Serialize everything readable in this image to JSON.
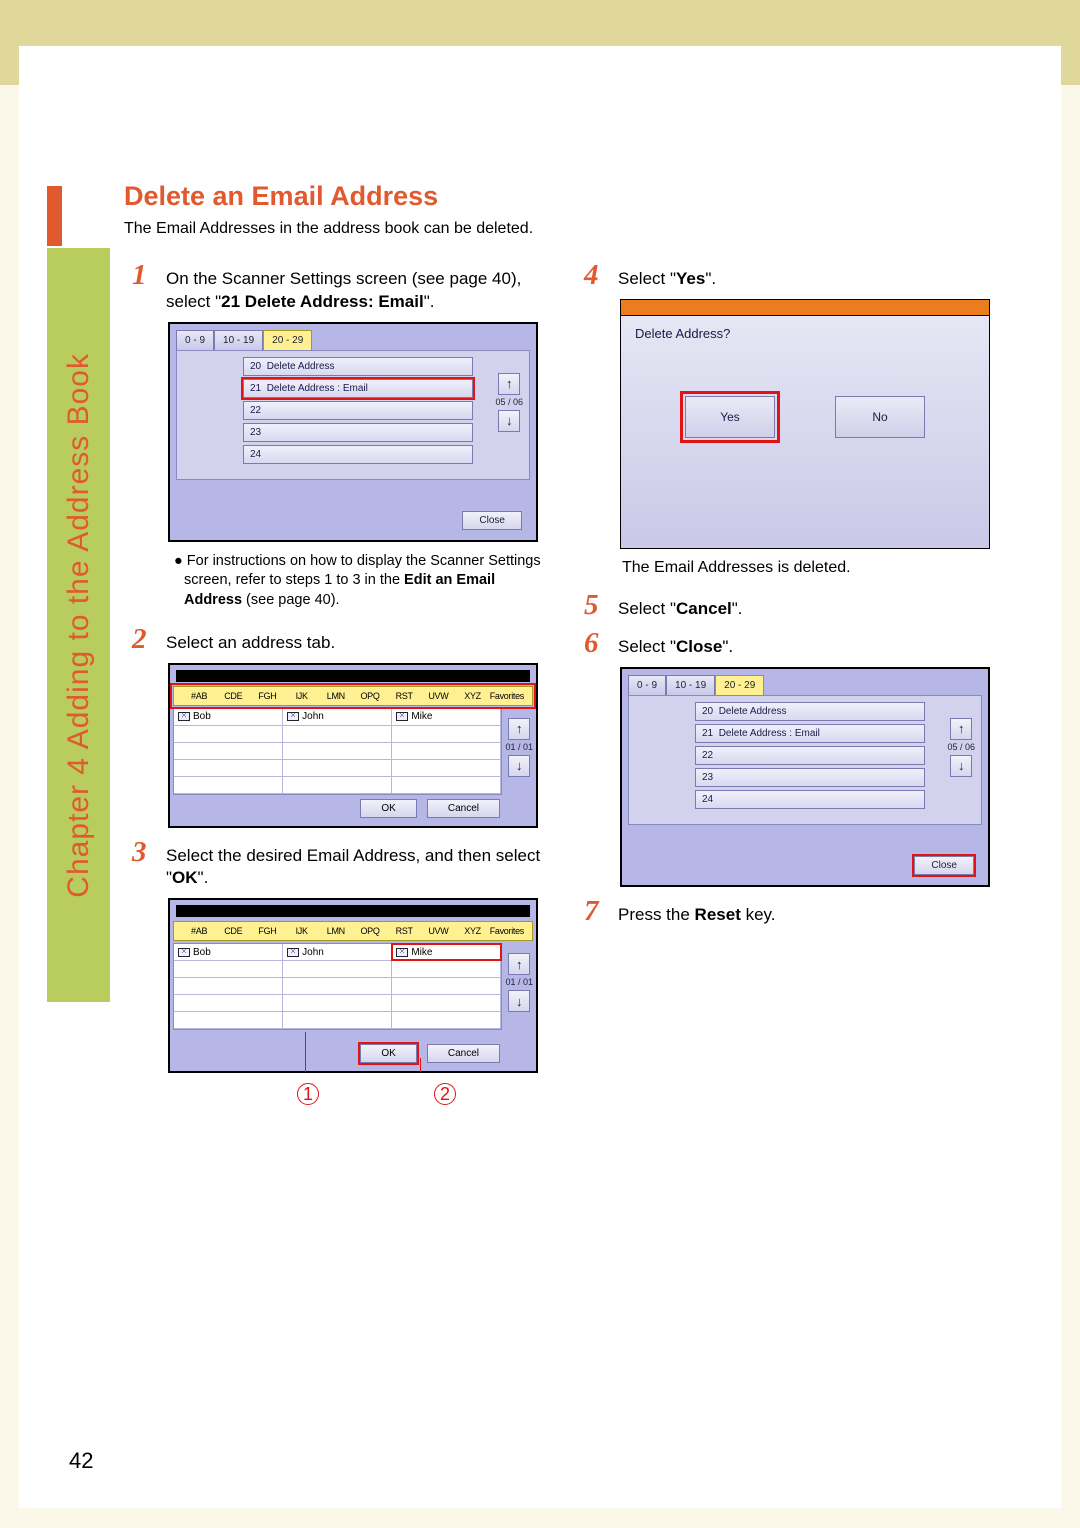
{
  "sidebar": {
    "chapter_label": "Chapter 4   Adding to the Address Book"
  },
  "page_number": "42",
  "section_title": "Delete an Email Address",
  "intro_text": "The Email Addresses in the address book can be deleted.",
  "steps": {
    "s1": {
      "num": "1",
      "text_pre": "On the Scanner Settings screen (see page 40), select \"",
      "bold": "21 Delete Address: Email",
      "text_post": "\"."
    },
    "s2": {
      "num": "2",
      "text": "Select an address tab."
    },
    "s3": {
      "num": "3",
      "text_pre": "Select the desired Email Address, and then select \"",
      "bold": "OK",
      "text_post": "\"."
    },
    "s4": {
      "num": "4",
      "text_pre": "Select \"",
      "bold": "Yes",
      "text_post": "\"."
    },
    "s4_result": "The Email Addresses is deleted.",
    "s5": {
      "num": "5",
      "text_pre": "Select \"",
      "bold": "Cancel",
      "text_post": "\"."
    },
    "s6": {
      "num": "6",
      "text_pre": "Select \"",
      "bold": "Close",
      "text_post": "\"."
    },
    "s7": {
      "num": "7",
      "text_pre": "Press the ",
      "bold": "Reset",
      "text_post": " key."
    }
  },
  "note1": {
    "bullet": "●",
    "text_pre": "For instructions on how to display the Scanner Settings screen, refer to steps 1 to 3 in the ",
    "bold": "Edit an Email Address",
    "text_post": " (see page 40)."
  },
  "screenshot1": {
    "tabs": [
      "0 - 9",
      "10 - 19",
      "20 - 29"
    ],
    "active_tab": 2,
    "items": [
      {
        "id": "20",
        "label": "Delete Address"
      },
      {
        "id": "21",
        "label": "Delete Address : Email"
      },
      {
        "id": "22",
        "label": ""
      },
      {
        "id": "23",
        "label": ""
      },
      {
        "id": "24",
        "label": ""
      }
    ],
    "scroll_count": "05 / 06",
    "close": "Close"
  },
  "screenshot2": {
    "tabs": [
      "#AB",
      "CDE",
      "FGH",
      "IJK",
      "LMN",
      "OPQ",
      "RST",
      "UVW",
      "XYZ",
      "Favorites"
    ],
    "names": [
      "Bob",
      "John",
      "Mike"
    ],
    "scroll_count": "01 / 01",
    "ok": "OK",
    "cancel": "Cancel"
  },
  "screenshot3": {
    "tabs": [
      "#AB",
      "CDE",
      "FGH",
      "IJK",
      "LMN",
      "OPQ",
      "RST",
      "UVW",
      "XYZ",
      "Favorites"
    ],
    "names": [
      "Bob",
      "John",
      "Mike"
    ],
    "scroll_count": "01 / 01",
    "ok": "OK",
    "cancel": "Cancel",
    "callout1": "1",
    "callout2": "2"
  },
  "screenshot4": {
    "question": "Delete Address?",
    "yes": "Yes",
    "no": "No"
  },
  "screenshot5": {
    "tabs": [
      "0 - 9",
      "10 - 19",
      "20 - 29"
    ],
    "active_tab": 2,
    "items": [
      {
        "id": "20",
        "label": "Delete Address"
      },
      {
        "id": "21",
        "label": "Delete Address : Email"
      },
      {
        "id": "22",
        "label": ""
      },
      {
        "id": "23",
        "label": ""
      },
      {
        "id": "24",
        "label": ""
      }
    ],
    "scroll_count": "05 / 06",
    "close": "Close"
  }
}
